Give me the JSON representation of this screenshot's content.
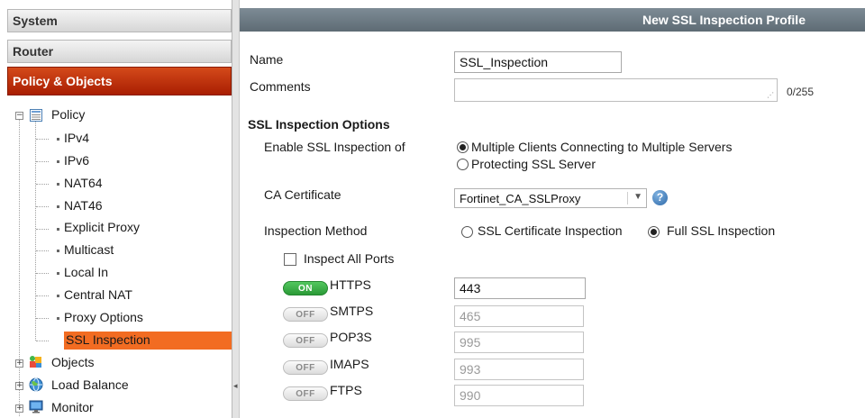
{
  "sidebar": {
    "headers": {
      "system": "System",
      "router": "Router",
      "policy_objects": "Policy & Objects"
    },
    "tree": {
      "policy": {
        "label": "Policy",
        "expander": "−",
        "children": [
          "IPv4",
          "IPv6",
          "NAT64",
          "NAT46",
          "Explicit Proxy",
          "Multicast",
          "Local In",
          "Central NAT",
          "Proxy Options",
          "SSL Inspection"
        ],
        "selected": "SSL Inspection"
      },
      "objects": {
        "label": "Objects",
        "expander": "+"
      },
      "load_balance": {
        "label": "Load Balance",
        "expander": "+"
      },
      "monitor": {
        "label": "Monitor",
        "expander": "+"
      }
    }
  },
  "header": {
    "title": "New SSL Inspection Profile"
  },
  "form": {
    "name_label": "Name",
    "name_value": "SSL_Inspection",
    "comments_label": "Comments",
    "comments_value": "",
    "comments_counter": "0/255",
    "section_title": "SSL Inspection Options",
    "enable_label": "Enable SSL Inspection of",
    "enable_options": {
      "multiple": "Multiple Clients Connecting to Multiple Servers",
      "protecting": "Protecting SSL Server"
    },
    "enable_selected": "Multiple Clients Connecting to Multiple Servers",
    "ca_label": "CA Certificate",
    "ca_value": "Fortinet_CA_SSLProxy",
    "help_glyph": "?",
    "method_label": "Inspection Method",
    "method_options": {
      "certificate": "SSL Certificate Inspection",
      "full": "Full SSL Inspection"
    },
    "method_selected": "Full SSL Inspection",
    "inspect_all_ports_label": "Inspect All Ports",
    "inspect_all_ports_checked": false,
    "protocols": [
      {
        "toggle": "ON",
        "name": "HTTPS",
        "port": "443",
        "enabled": true
      },
      {
        "toggle": "OFF",
        "name": "SMTPS",
        "port": "465",
        "enabled": false
      },
      {
        "toggle": "OFF",
        "name": "POP3S",
        "port": "995",
        "enabled": false
      },
      {
        "toggle": "OFF",
        "name": "IMAPS",
        "port": "993",
        "enabled": false
      },
      {
        "toggle": "OFF",
        "name": "FTPS",
        "port": "990",
        "enabled": false
      }
    ]
  },
  "colors": {
    "accent_red": "#b8260a",
    "selected_orange": "#f26c22",
    "titlebar": "#6b7881",
    "toggle_on": "#35a841"
  },
  "icons": {
    "policy": "list-document-icon",
    "objects": "colored-objects-icon",
    "load_balance": "globe-icon",
    "monitor": "monitor-icon",
    "help": "help-question-icon",
    "splitter": "collapse-arrow-icon"
  }
}
